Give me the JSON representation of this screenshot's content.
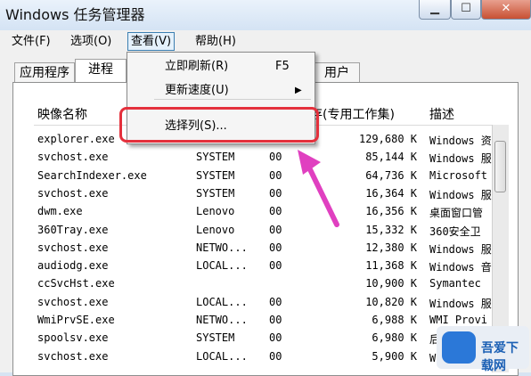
{
  "window": {
    "title": "Windows 任务管理器"
  },
  "menus": [
    "文件(F)",
    "选项(O)",
    "查看(V)",
    "帮助(H)"
  ],
  "tabs": {
    "left": "应用程序",
    "selected": "进程",
    "right": "用户"
  },
  "columns": {
    "name": "映像名称",
    "memory": "存(专用工作集)",
    "desc": "描述"
  },
  "dropdown": {
    "refresh": "立即刷新(R)",
    "refresh_key": "F5",
    "speed": "更新速度(U)",
    "select_columns": "选择列(S)..."
  },
  "rows": [
    {
      "name": "explorer.exe",
      "user": "",
      "cpu": "",
      "mem": "129,680 K",
      "desc": "Windows 资"
    },
    {
      "name": "svchost.exe",
      "user": "SYSTEM",
      "cpu": "00",
      "mem": "85,144 K",
      "desc": "Windows 服"
    },
    {
      "name": "SearchIndexer.exe",
      "user": "SYSTEM",
      "cpu": "00",
      "mem": "64,736 K",
      "desc": "Microsoft"
    },
    {
      "name": "svchost.exe",
      "user": "SYSTEM",
      "cpu": "00",
      "mem": "16,364 K",
      "desc": "Windows 服"
    },
    {
      "name": "dwm.exe",
      "user": "Lenovo",
      "cpu": "00",
      "mem": "16,356 K",
      "desc": "桌面窗口管"
    },
    {
      "name": "360Tray.exe",
      "user": "Lenovo",
      "cpu": "00",
      "mem": "15,332 K",
      "desc": "360安全卫"
    },
    {
      "name": "svchost.exe",
      "user": "NETWO...",
      "cpu": "00",
      "mem": "12,380 K",
      "desc": "Windows 服"
    },
    {
      "name": "audiodg.exe",
      "user": "LOCAL...",
      "cpu": "00",
      "mem": "11,368 K",
      "desc": "Windows 音"
    },
    {
      "name": "ccSvcHst.exe",
      "user": "",
      "cpu": "",
      "mem": "10,900 K",
      "desc": "Symantec"
    },
    {
      "name": "svchost.exe",
      "user": "LOCAL...",
      "cpu": "00",
      "mem": "10,820 K",
      "desc": "Windows 服"
    },
    {
      "name": "WmiPrvSE.exe",
      "user": "NETWO...",
      "cpu": "00",
      "mem": "6,988 K",
      "desc": "WMI Provi"
    },
    {
      "name": "spoolsv.exe",
      "user": "SYSTEM",
      "cpu": "00",
      "mem": "6,980 K",
      "desc": "后台处理"
    },
    {
      "name": "svchost.exe",
      "user": "LOCAL...",
      "cpu": "00",
      "mem": "5,900 K",
      "desc": "Windows 服"
    }
  ],
  "watermark": {
    "text": "吾爱下载网"
  },
  "colors": {
    "highlight": "#e4303c",
    "arrow": "#e040c0"
  },
  "icons": {
    "minimize": "minimize-icon",
    "maximize": "maximize-icon",
    "close": "close-icon",
    "submenu": "chevron-right-icon"
  }
}
